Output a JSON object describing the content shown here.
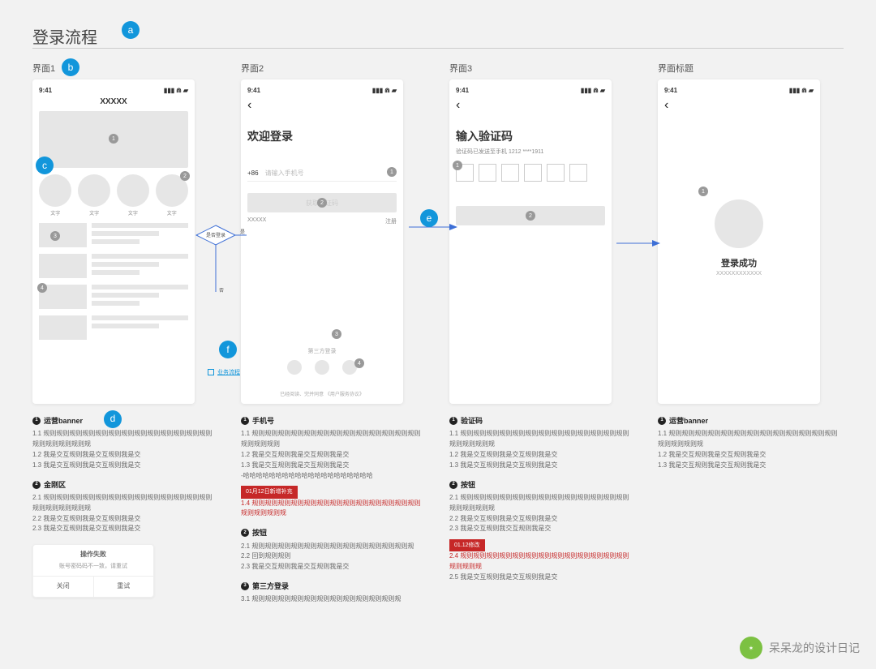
{
  "flow_title": "登录流程",
  "letters": {
    "a": "a",
    "b": "b",
    "c": "c",
    "d": "d",
    "e": "e",
    "f": "f"
  },
  "status": {
    "time": "9:41"
  },
  "screens": [
    {
      "label": "界面1",
      "nav_title": "XXXXX",
      "grid_label": "文字"
    },
    {
      "label": "界面2",
      "title": "欢迎登录",
      "prefix": "+86",
      "placeholder": "请输入手机号",
      "btn": "获取验证码",
      "left": "XXXXX",
      "right": "注册",
      "third_label": "第三方登录",
      "agreement": "已经阅读、完并同意 《用户服务协议》"
    },
    {
      "label": "界面3",
      "title": "输入验证码",
      "subtitle": "验证码已发送至手机 1212 ****1911"
    },
    {
      "label": "界面标题",
      "success_title": "登录成功",
      "success_sub": "XXXXXXXXXXXX"
    }
  ],
  "diamond_label": "是否\\n登录",
  "link_text": "业务流程",
  "col1": {
    "s1_title": "运营banner",
    "s1_lines": [
      "1.1 规则规则规则规则规则规则规则规则规则规则规则规则规则规则规则规则规则规",
      "1.2 我是交互规则我是交互规则我是交",
      "1.3 我是交互规则我是交互规则我是交"
    ],
    "s2_title": "金刚区",
    "s2_lines": [
      "2.1 规则规则规则规则规则规则规则规则规则规则规则规则规则规则规则规则规则规",
      "2.2 我是交互规则我是交互规则我是交",
      "2.3 我是交互规则我是交互规则我是交"
    ],
    "dialog_title": "操作失败",
    "dialog_sub": "账号密码码不一致，请重试",
    "dialog_close": "关闭",
    "dialog_retry": "重试"
  },
  "col2": {
    "s1_title": "手机号",
    "s1_lines": [
      "1.1 规则规则规则规则规则规则规则规则规则规则规则规则规则规则规则规则",
      "1.2 我是交互规则我是交互规则我是交",
      "1.3 我是交互规则我是交互规则我是交",
      "-哈哈哈哈哈哈哈哈哈哈哈哈哈哈哈哈哈哈哈哈"
    ],
    "tag": "01月12日新增补充",
    "tag_text": "1.4 规则规则规则规则规则规则规则规则规则规则规则规则规则规则规则规则规",
    "s2_title": "按钮",
    "s2_lines": [
      "2.1 规则规则规则规则规则规则规则规则规则规则规则规则规",
      "2.2 回到规则规则",
      "2.3 我是交互规则我是交互规则我是交"
    ],
    "s3_title": "第三方登录",
    "s3_lines": [
      "3.1 规则规则规则规则规则规则规则规则规则规则规则规"
    ]
  },
  "col3": {
    "s1_title": "验证码",
    "s1_lines": [
      "1.1 规则规则规则规则规则规则规则规则规则规则规则规则规则规则规则规则规",
      "1.2 我是交互规则我是交互规则我是交",
      "1.3 我是交互规则我是交互规则我是交"
    ],
    "s2_title": "按钮",
    "s2_lines": [
      "2.1 规则规则规则规则规则规则规则规则规则规则规则规则规则规则规则规则规",
      "2.2 我是交互规则我是交互规则我是交",
      "2.3 我是交互规则我交互规则我是交"
    ],
    "tag": "01.12修改",
    "tag_text": "2.4 规则规则规则规则规则规则规则规则规则规则规则规则规则规则规则规",
    "extra": "2.5 我是交互规则我是交互规则我是交"
  },
  "col4": {
    "s1_title": "运营banner",
    "s1_lines": [
      "1.1 规则规则规则规则规则规则规则规则规则规则规则规则规则规则规则规则规",
      "1.2 我是交互规则我是交互规则我是交",
      "1.3 我是交互规则我是交互规则我是交"
    ]
  },
  "footer": "呆呆龙的设计日记"
}
